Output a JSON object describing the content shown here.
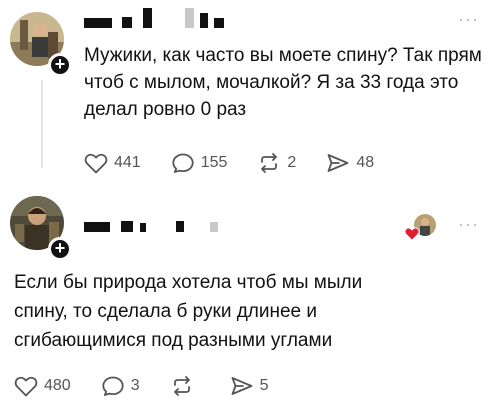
{
  "posts": [
    {
      "text": "Мужики, как часто вы моете спину? Так прям чтоб с мылом, мочалкой? Я за 33 года это делал ровно 0 раз",
      "more": "···",
      "follow_glyph": "+",
      "actions": {
        "likes": "441",
        "replies": "155",
        "reposts": "2",
        "shares": "48"
      }
    },
    {
      "text": "Если бы природа хотела чтоб мы мыли спину, то сделала б руки длинее и сгибающимися под разными углами",
      "more": "···",
      "follow_glyph": "+",
      "actions": {
        "likes": "480",
        "replies": "3",
        "reposts": "",
        "shares": "5"
      }
    }
  ],
  "icons": {
    "like": "heart-outline-icon",
    "reply": "speech-bubble-icon",
    "repost": "repost-arrows-icon",
    "share": "send-icon",
    "liked_by_author": "red-heart-icon"
  },
  "colors": {
    "text": "#111111",
    "muted": "#555555",
    "heart_red": "#e0202e"
  }
}
